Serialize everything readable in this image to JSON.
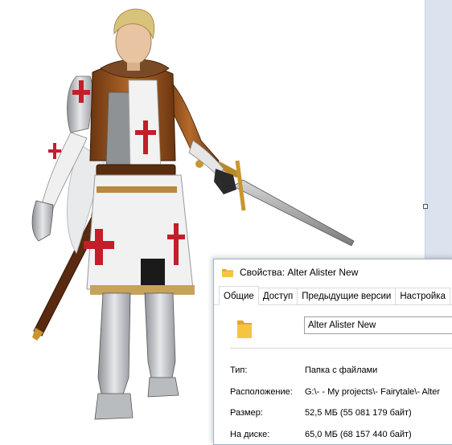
{
  "dialog": {
    "title": "Свойства: Alter Alister New",
    "tabs": [
      "Общие",
      "Доступ",
      "Предыдущие версии",
      "Настройка"
    ],
    "active_tab": "Общие",
    "name_value": "Alter Alister New",
    "properties": [
      {
        "label": "Тип:",
        "value": "Папка с файлами"
      },
      {
        "label": "Расположение:",
        "value": "G:\\- - My projects\\- Fairytale\\- Alter"
      },
      {
        "label": "Размер:",
        "value": "52,5 МБ (55 081 179 байт)"
      },
      {
        "label": "На диске:",
        "value": "65,0 МБ (68 157 440 байт)"
      }
    ]
  },
  "colors": {
    "folder": "#f5c542",
    "folder_dark": "#e0a82e",
    "tunic": "#f2f2f2",
    "cross": "#c41e2a",
    "leather": "#8a4b1e",
    "armor": "#c7c9cc",
    "hair": "#d9c27a"
  },
  "icons": {
    "title_icon": "folder-icon",
    "large_icon": "folder-icon"
  }
}
